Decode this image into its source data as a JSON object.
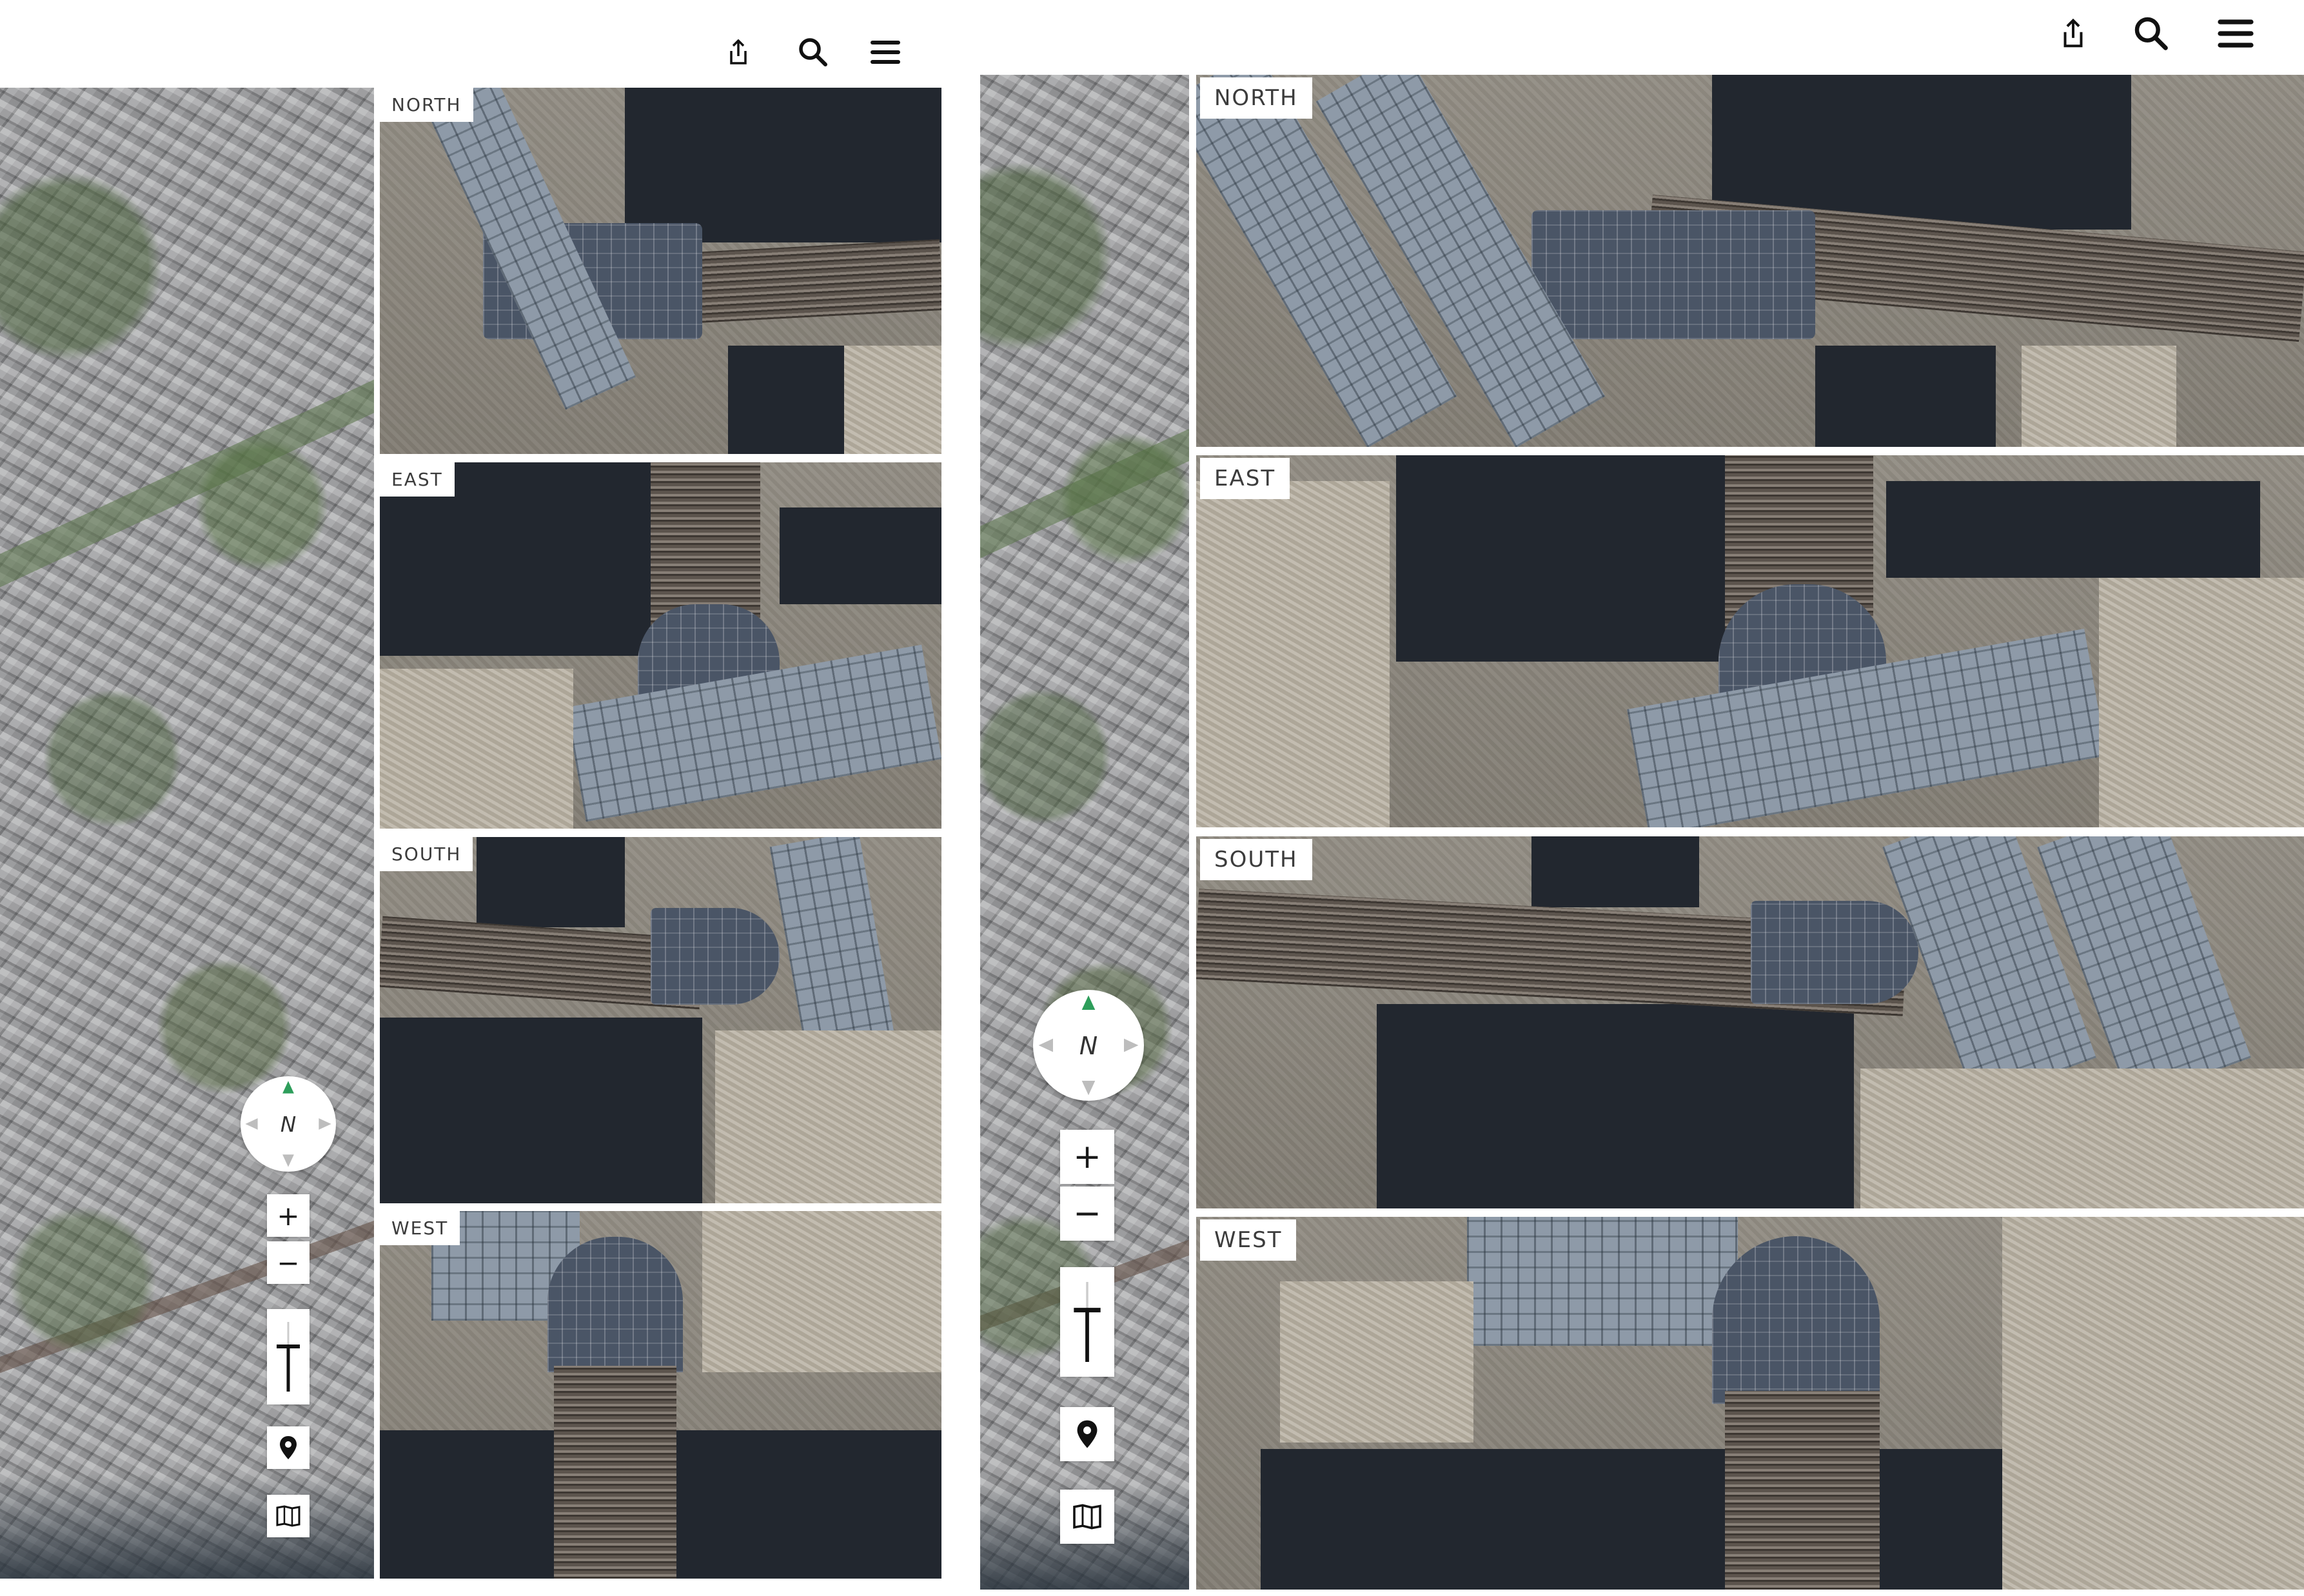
{
  "toolbar": {
    "icons": [
      "share-icon",
      "search-icon",
      "menu-icon"
    ]
  },
  "oblique_views": {
    "north_label": "NORTH",
    "east_label": "EAST",
    "south_label": "SOUTH",
    "west_label": "WEST"
  },
  "compass": {
    "north_letter": "N",
    "needle_color": "#2e9e5b"
  },
  "zoom": {
    "in_label": "+",
    "out_label": "−"
  },
  "controls": {
    "icons": [
      "tilt-icon",
      "location-pin-icon",
      "map-book-icon"
    ]
  },
  "colors": {
    "water": "#22272f",
    "panel_bg": "#ffffff",
    "label_text": "#3c3c3c"
  }
}
